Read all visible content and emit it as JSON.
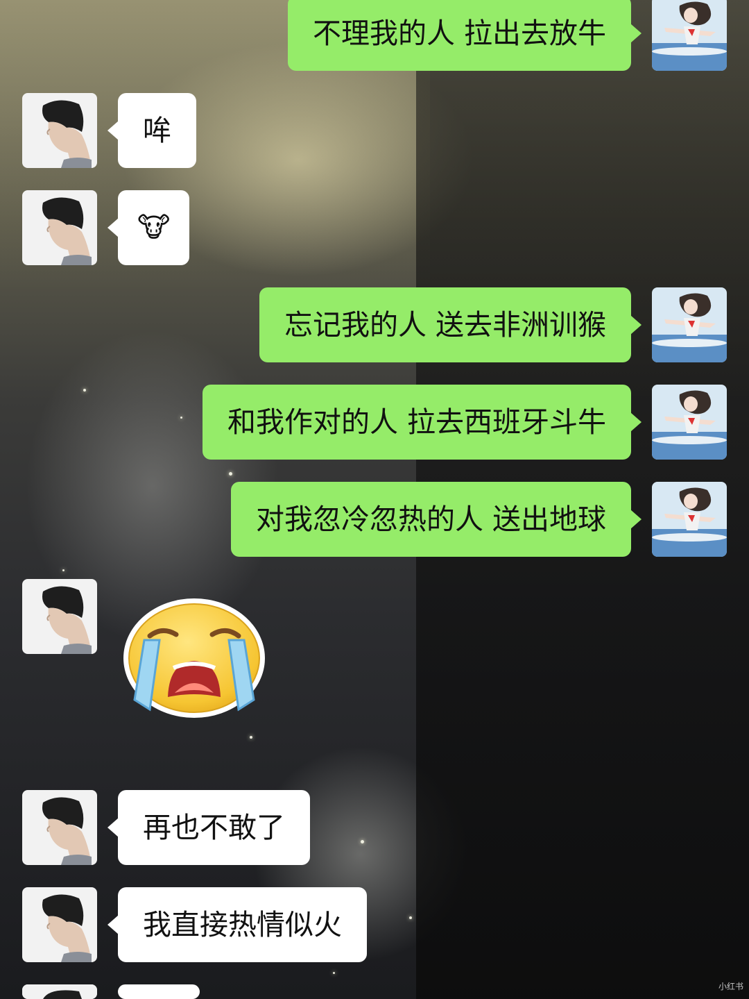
{
  "messages": [
    {
      "side": "out",
      "text": "不理我的人 拉出去放牛"
    },
    {
      "side": "in",
      "text": "哞"
    },
    {
      "side": "in",
      "icon": "cow-face-emoji",
      "text": "🐮"
    },
    {
      "side": "out",
      "text": "忘记我的人 送去非洲训猴"
    },
    {
      "side": "out",
      "text": "和我作对的人 拉去西班牙斗牛"
    },
    {
      "side": "out",
      "text": "对我忽冷忽热的人 送出地球"
    },
    {
      "side": "in",
      "icon": "crying-face-sticker"
    },
    {
      "side": "in",
      "text": "再也不敢了"
    },
    {
      "side": "in",
      "text": "我直接热情似火"
    }
  ],
  "avatars": {
    "self": "anime-girl-avatar",
    "other": "man-profile-avatar"
  },
  "colors": {
    "outgoing_bubble": "#95ec69",
    "incoming_bubble": "#ffffff"
  },
  "watermark": "小红书"
}
